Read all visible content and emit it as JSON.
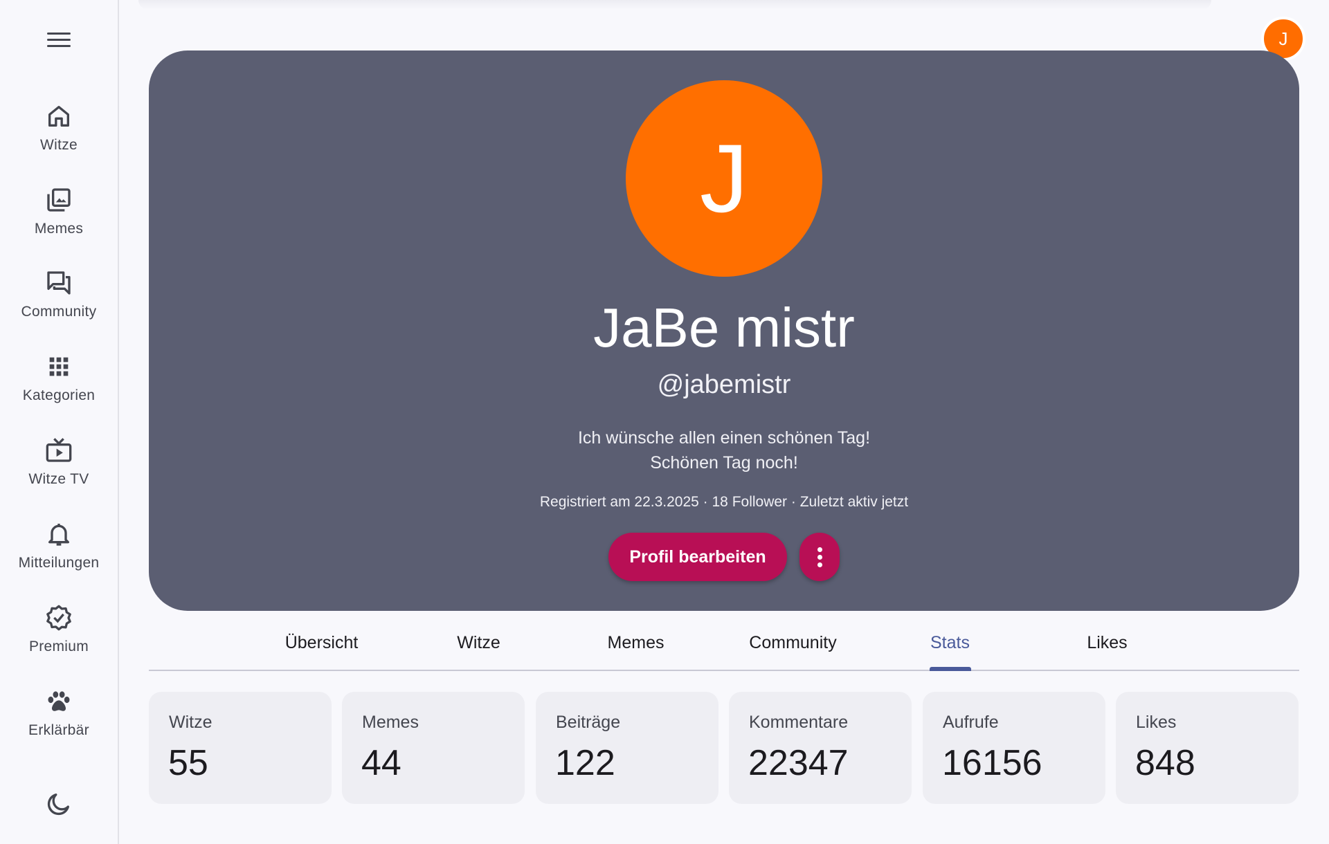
{
  "sidebar": {
    "items": [
      {
        "label": "Witze",
        "icon": "home-icon"
      },
      {
        "label": "Memes",
        "icon": "photo-library-icon"
      },
      {
        "label": "Community",
        "icon": "forum-icon"
      },
      {
        "label": "Kategorien",
        "icon": "grid-icon"
      },
      {
        "label": "Witze TV",
        "icon": "tv-play-icon"
      },
      {
        "label": "Mitteilungen",
        "icon": "bell-icon"
      },
      {
        "label": "Premium",
        "icon": "verified-badge-icon"
      },
      {
        "label": "Erklärbär",
        "icon": "paw-icon"
      }
    ]
  },
  "header": {
    "avatar_initial": "J"
  },
  "profile": {
    "avatar_initial": "J",
    "name": "JaBe mistr",
    "handle": "@jabemistr",
    "bio_line1": "Ich wünsche allen einen schönen Tag!",
    "bio_line2": "Schönen Tag noch!",
    "meta": "Registriert am 22.3.2025 · 18 Follower · Zuletzt aktiv jetzt",
    "edit_label": "Profil bearbeiten"
  },
  "tabs": [
    {
      "label": "Übersicht"
    },
    {
      "label": "Witze"
    },
    {
      "label": "Memes"
    },
    {
      "label": "Community"
    },
    {
      "label": "Stats",
      "active": true
    },
    {
      "label": "Likes"
    }
  ],
  "stats": [
    {
      "label": "Witze",
      "value": "55"
    },
    {
      "label": "Memes",
      "value": "44"
    },
    {
      "label": "Beiträge",
      "value": "122"
    },
    {
      "label": "Kommentare",
      "value": "22347"
    },
    {
      "label": "Aufrufe",
      "value": "16156"
    },
    {
      "label": "Likes",
      "value": "848"
    }
  ],
  "colors": {
    "accent": "#4a5a9a",
    "primary_button": "#b80f55",
    "avatar": "#ff6f00",
    "card": "#5b5e72"
  }
}
